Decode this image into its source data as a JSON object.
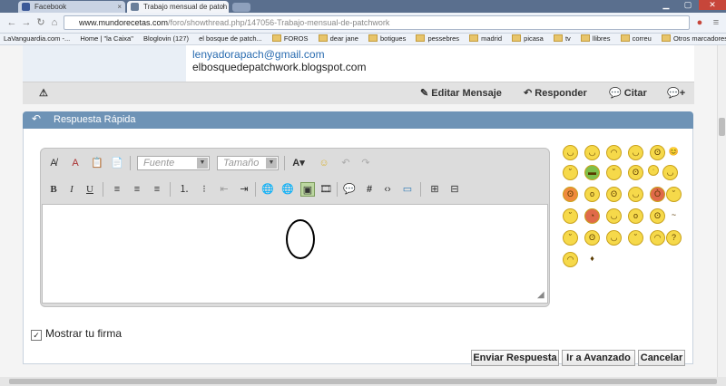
{
  "browser": {
    "tabs": [
      {
        "label": "Facebook",
        "icon": "facebook-icon",
        "close": "×"
      },
      {
        "label": "Trabajo mensual de patch",
        "icon": "page-icon",
        "close": "×"
      }
    ],
    "url_host": "www.mundorecetas.com",
    "url_path": "/foro/showthread.php/147056-Trabajo-mensual-de-patchwork",
    "bookmarks": [
      "LaVanguardia.com -...",
      "Home | \"la Caixa\"",
      "Bloglovin (127)",
      "el bosque de patch...",
      "FOROS",
      "dear jane",
      "botigues",
      "pessebres",
      "madrid",
      "picasa",
      "tv",
      "llibres",
      "correu"
    ],
    "other_bookmarks": "Otros marcadores"
  },
  "post": {
    "email": "lenyadorapach@gmail.com",
    "blog": "elbosquedepatchwork.blogspot.com",
    "actions": {
      "edit": "Editar Mensaje",
      "reply": "Responder",
      "quote": "Citar"
    }
  },
  "quick_reply": {
    "title": "Respuesta Rápida",
    "font_placeholder": "Fuente",
    "size_placeholder": "Tamaño",
    "format": {
      "bold": "B",
      "italic": "I",
      "underline": "U"
    },
    "signature_label": "Mostrar tu firma",
    "buttons": {
      "submit": "Enviar Respuesta",
      "advanced": "Ir a Avanzado",
      "cancel": "Cancelar"
    }
  },
  "colors": {
    "header": "#6e93b6",
    "link": "#2a6cb0"
  }
}
